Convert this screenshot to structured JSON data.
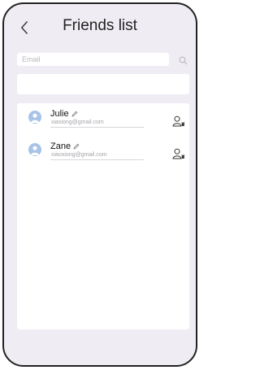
{
  "header": {
    "title": "Friends list"
  },
  "search": {
    "placeholder": "Email",
    "value": ""
  },
  "friends": [
    {
      "name": "Julie",
      "email": "xiaxiong@gmail.com"
    },
    {
      "name": "Zane",
      "email": "xiaoxiong@gmail.com"
    }
  ],
  "colors": {
    "background": "#efedf3",
    "card": "#ffffff",
    "avatar": "#a7c3e8",
    "divider": "#d7d7dc"
  },
  "icons": {
    "back": "chevron-left-icon",
    "search": "search-icon",
    "avatar": "user-avatar-icon",
    "edit": "pencil-icon",
    "delete": "delete-user-icon"
  }
}
